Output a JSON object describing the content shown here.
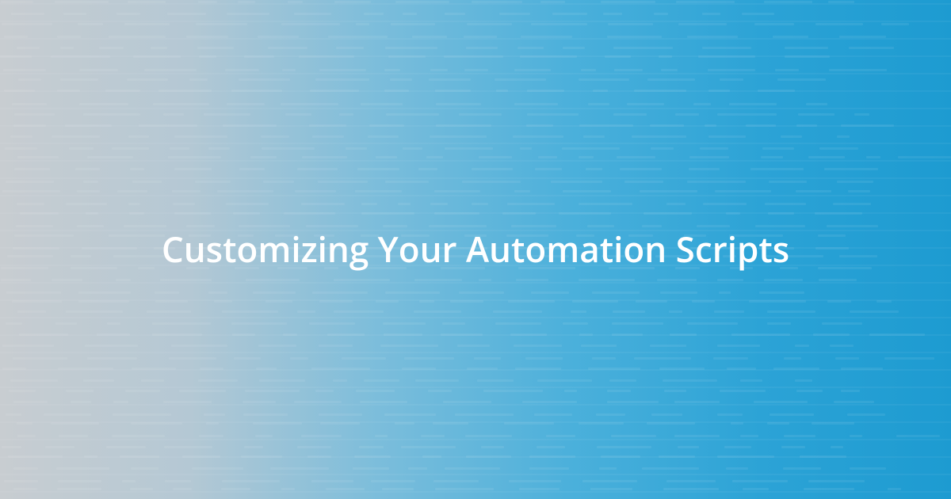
{
  "title": "Customizing Your Automation Scripts",
  "colors": {
    "gradient_start": "#c8cdd1",
    "gradient_end": "#1d9bd1",
    "text": "#ffffff"
  }
}
